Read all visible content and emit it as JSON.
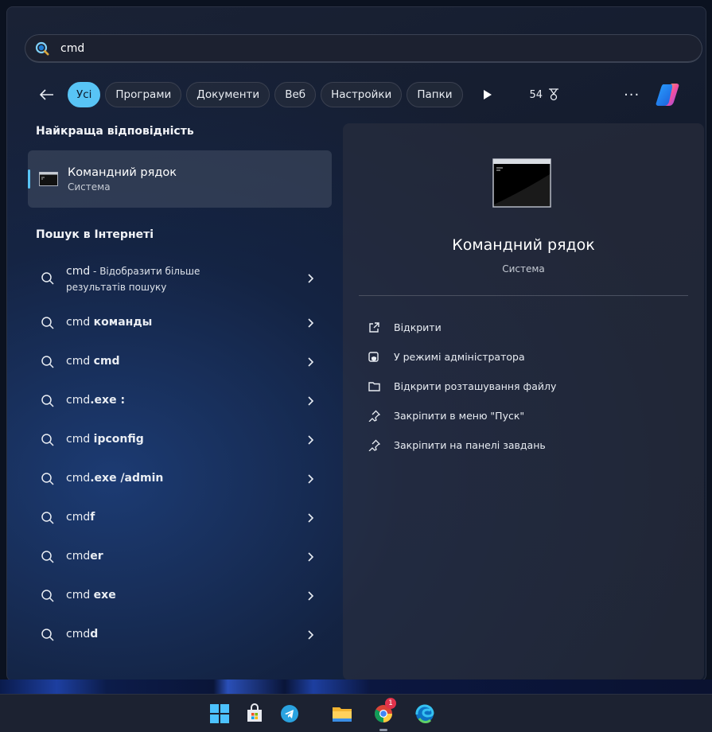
{
  "search": {
    "query": "cmd"
  },
  "filters": {
    "back_label": "←",
    "chips": [
      "Усі",
      "Програми",
      "Документи",
      "Веб",
      "Настройки",
      "Папки"
    ],
    "count": "54",
    "more_label": "···"
  },
  "left": {
    "best_match_title": "Найкраща відповідність",
    "best_match": {
      "title": "Командний рядок",
      "subtitle": "Система"
    },
    "web_title": "Пошук в Інтернеті",
    "results": [
      {
        "pre": "cmd",
        "bold": "",
        "suffix": " - Відобразити більше",
        "line2": "результатів пошуку"
      },
      {
        "pre": "cmd ",
        "bold": "команды",
        "suffix": "",
        "line2": ""
      },
      {
        "pre": "cmd ",
        "bold": "cmd",
        "suffix": "",
        "line2": ""
      },
      {
        "pre": "cmd",
        "bold": ".exe :",
        "suffix": "",
        "line2": ""
      },
      {
        "pre": "cmd ",
        "bold": "ipconfig",
        "suffix": "",
        "line2": ""
      },
      {
        "pre": "cmd",
        "bold": ".exe /admin",
        "suffix": "",
        "line2": ""
      },
      {
        "pre": "cmd",
        "bold": "f",
        "suffix": "",
        "line2": ""
      },
      {
        "pre": "cmd",
        "bold": "er",
        "suffix": "",
        "line2": ""
      },
      {
        "pre": "cmd ",
        "bold": "exe",
        "suffix": "",
        "line2": ""
      },
      {
        "pre": "cmd",
        "bold": "d",
        "suffix": "",
        "line2": ""
      }
    ]
  },
  "preview": {
    "title": "Командний рядок",
    "subtitle": "Система",
    "actions": [
      {
        "label": "Відкрити",
        "icon": "open-external-icon"
      },
      {
        "label": "У режимі адміністратора",
        "icon": "run-as-admin-icon"
      },
      {
        "label": "Відкрити розташування файлу",
        "icon": "folder-icon"
      },
      {
        "label": "Закріпити в меню \"Пуск\"",
        "icon": "pin-icon"
      },
      {
        "label": "Закріпити на панелі завдань",
        "icon": "pin-icon"
      }
    ]
  },
  "taskbar": {
    "items": [
      "windows-start-icon",
      "microsoft-store-icon",
      "telegram-icon",
      "file-explorer-icon",
      "chrome-icon",
      "edge-icon"
    ],
    "chrome_badge": "1"
  },
  "colors": {
    "accent": "#58c4f5",
    "panel": "#141c2e",
    "taskbar": "#1c2231"
  }
}
